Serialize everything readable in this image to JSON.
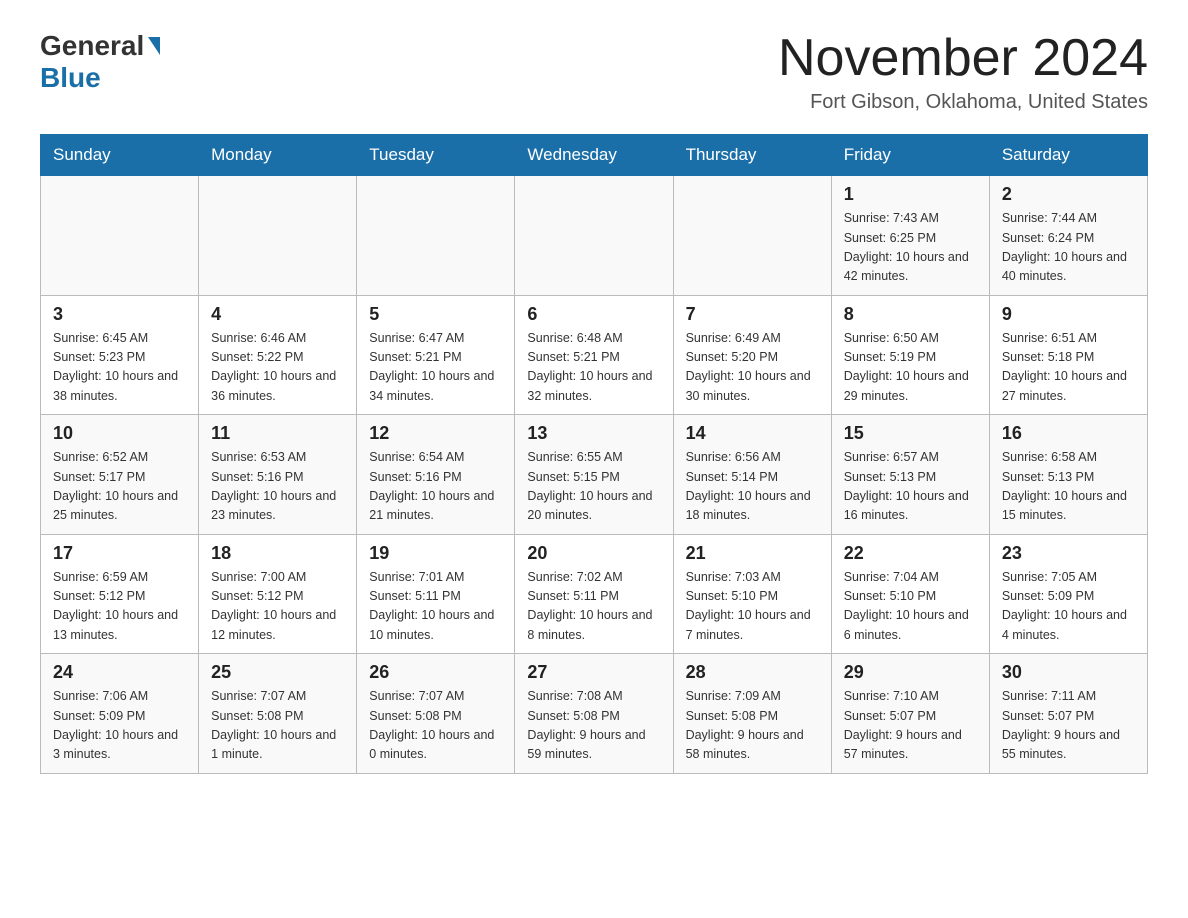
{
  "header": {
    "logo": {
      "part1": "General",
      "part2": "Blue"
    },
    "title": "November 2024",
    "subtitle": "Fort Gibson, Oklahoma, United States"
  },
  "calendar": {
    "weekdays": [
      "Sunday",
      "Monday",
      "Tuesday",
      "Wednesday",
      "Thursday",
      "Friday",
      "Saturday"
    ],
    "weeks": [
      [
        {
          "day": "",
          "sunrise": "",
          "sunset": "",
          "daylight": ""
        },
        {
          "day": "",
          "sunrise": "",
          "sunset": "",
          "daylight": ""
        },
        {
          "day": "",
          "sunrise": "",
          "sunset": "",
          "daylight": ""
        },
        {
          "day": "",
          "sunrise": "",
          "sunset": "",
          "daylight": ""
        },
        {
          "day": "",
          "sunrise": "",
          "sunset": "",
          "daylight": ""
        },
        {
          "day": "1",
          "sunrise": "Sunrise: 7:43 AM",
          "sunset": "Sunset: 6:25 PM",
          "daylight": "Daylight: 10 hours and 42 minutes."
        },
        {
          "day": "2",
          "sunrise": "Sunrise: 7:44 AM",
          "sunset": "Sunset: 6:24 PM",
          "daylight": "Daylight: 10 hours and 40 minutes."
        }
      ],
      [
        {
          "day": "3",
          "sunrise": "Sunrise: 6:45 AM",
          "sunset": "Sunset: 5:23 PM",
          "daylight": "Daylight: 10 hours and 38 minutes."
        },
        {
          "day": "4",
          "sunrise": "Sunrise: 6:46 AM",
          "sunset": "Sunset: 5:22 PM",
          "daylight": "Daylight: 10 hours and 36 minutes."
        },
        {
          "day": "5",
          "sunrise": "Sunrise: 6:47 AM",
          "sunset": "Sunset: 5:21 PM",
          "daylight": "Daylight: 10 hours and 34 minutes."
        },
        {
          "day": "6",
          "sunrise": "Sunrise: 6:48 AM",
          "sunset": "Sunset: 5:21 PM",
          "daylight": "Daylight: 10 hours and 32 minutes."
        },
        {
          "day": "7",
          "sunrise": "Sunrise: 6:49 AM",
          "sunset": "Sunset: 5:20 PM",
          "daylight": "Daylight: 10 hours and 30 minutes."
        },
        {
          "day": "8",
          "sunrise": "Sunrise: 6:50 AM",
          "sunset": "Sunset: 5:19 PM",
          "daylight": "Daylight: 10 hours and 29 minutes."
        },
        {
          "day": "9",
          "sunrise": "Sunrise: 6:51 AM",
          "sunset": "Sunset: 5:18 PM",
          "daylight": "Daylight: 10 hours and 27 minutes."
        }
      ],
      [
        {
          "day": "10",
          "sunrise": "Sunrise: 6:52 AM",
          "sunset": "Sunset: 5:17 PM",
          "daylight": "Daylight: 10 hours and 25 minutes."
        },
        {
          "day": "11",
          "sunrise": "Sunrise: 6:53 AM",
          "sunset": "Sunset: 5:16 PM",
          "daylight": "Daylight: 10 hours and 23 minutes."
        },
        {
          "day": "12",
          "sunrise": "Sunrise: 6:54 AM",
          "sunset": "Sunset: 5:16 PM",
          "daylight": "Daylight: 10 hours and 21 minutes."
        },
        {
          "day": "13",
          "sunrise": "Sunrise: 6:55 AM",
          "sunset": "Sunset: 5:15 PM",
          "daylight": "Daylight: 10 hours and 20 minutes."
        },
        {
          "day": "14",
          "sunrise": "Sunrise: 6:56 AM",
          "sunset": "Sunset: 5:14 PM",
          "daylight": "Daylight: 10 hours and 18 minutes."
        },
        {
          "day": "15",
          "sunrise": "Sunrise: 6:57 AM",
          "sunset": "Sunset: 5:13 PM",
          "daylight": "Daylight: 10 hours and 16 minutes."
        },
        {
          "day": "16",
          "sunrise": "Sunrise: 6:58 AM",
          "sunset": "Sunset: 5:13 PM",
          "daylight": "Daylight: 10 hours and 15 minutes."
        }
      ],
      [
        {
          "day": "17",
          "sunrise": "Sunrise: 6:59 AM",
          "sunset": "Sunset: 5:12 PM",
          "daylight": "Daylight: 10 hours and 13 minutes."
        },
        {
          "day": "18",
          "sunrise": "Sunrise: 7:00 AM",
          "sunset": "Sunset: 5:12 PM",
          "daylight": "Daylight: 10 hours and 12 minutes."
        },
        {
          "day": "19",
          "sunrise": "Sunrise: 7:01 AM",
          "sunset": "Sunset: 5:11 PM",
          "daylight": "Daylight: 10 hours and 10 minutes."
        },
        {
          "day": "20",
          "sunrise": "Sunrise: 7:02 AM",
          "sunset": "Sunset: 5:11 PM",
          "daylight": "Daylight: 10 hours and 8 minutes."
        },
        {
          "day": "21",
          "sunrise": "Sunrise: 7:03 AM",
          "sunset": "Sunset: 5:10 PM",
          "daylight": "Daylight: 10 hours and 7 minutes."
        },
        {
          "day": "22",
          "sunrise": "Sunrise: 7:04 AM",
          "sunset": "Sunset: 5:10 PM",
          "daylight": "Daylight: 10 hours and 6 minutes."
        },
        {
          "day": "23",
          "sunrise": "Sunrise: 7:05 AM",
          "sunset": "Sunset: 5:09 PM",
          "daylight": "Daylight: 10 hours and 4 minutes."
        }
      ],
      [
        {
          "day": "24",
          "sunrise": "Sunrise: 7:06 AM",
          "sunset": "Sunset: 5:09 PM",
          "daylight": "Daylight: 10 hours and 3 minutes."
        },
        {
          "day": "25",
          "sunrise": "Sunrise: 7:07 AM",
          "sunset": "Sunset: 5:08 PM",
          "daylight": "Daylight: 10 hours and 1 minute."
        },
        {
          "day": "26",
          "sunrise": "Sunrise: 7:07 AM",
          "sunset": "Sunset: 5:08 PM",
          "daylight": "Daylight: 10 hours and 0 minutes."
        },
        {
          "day": "27",
          "sunrise": "Sunrise: 7:08 AM",
          "sunset": "Sunset: 5:08 PM",
          "daylight": "Daylight: 9 hours and 59 minutes."
        },
        {
          "day": "28",
          "sunrise": "Sunrise: 7:09 AM",
          "sunset": "Sunset: 5:08 PM",
          "daylight": "Daylight: 9 hours and 58 minutes."
        },
        {
          "day": "29",
          "sunrise": "Sunrise: 7:10 AM",
          "sunset": "Sunset: 5:07 PM",
          "daylight": "Daylight: 9 hours and 57 minutes."
        },
        {
          "day": "30",
          "sunrise": "Sunrise: 7:11 AM",
          "sunset": "Sunset: 5:07 PM",
          "daylight": "Daylight: 9 hours and 55 minutes."
        }
      ]
    ]
  }
}
